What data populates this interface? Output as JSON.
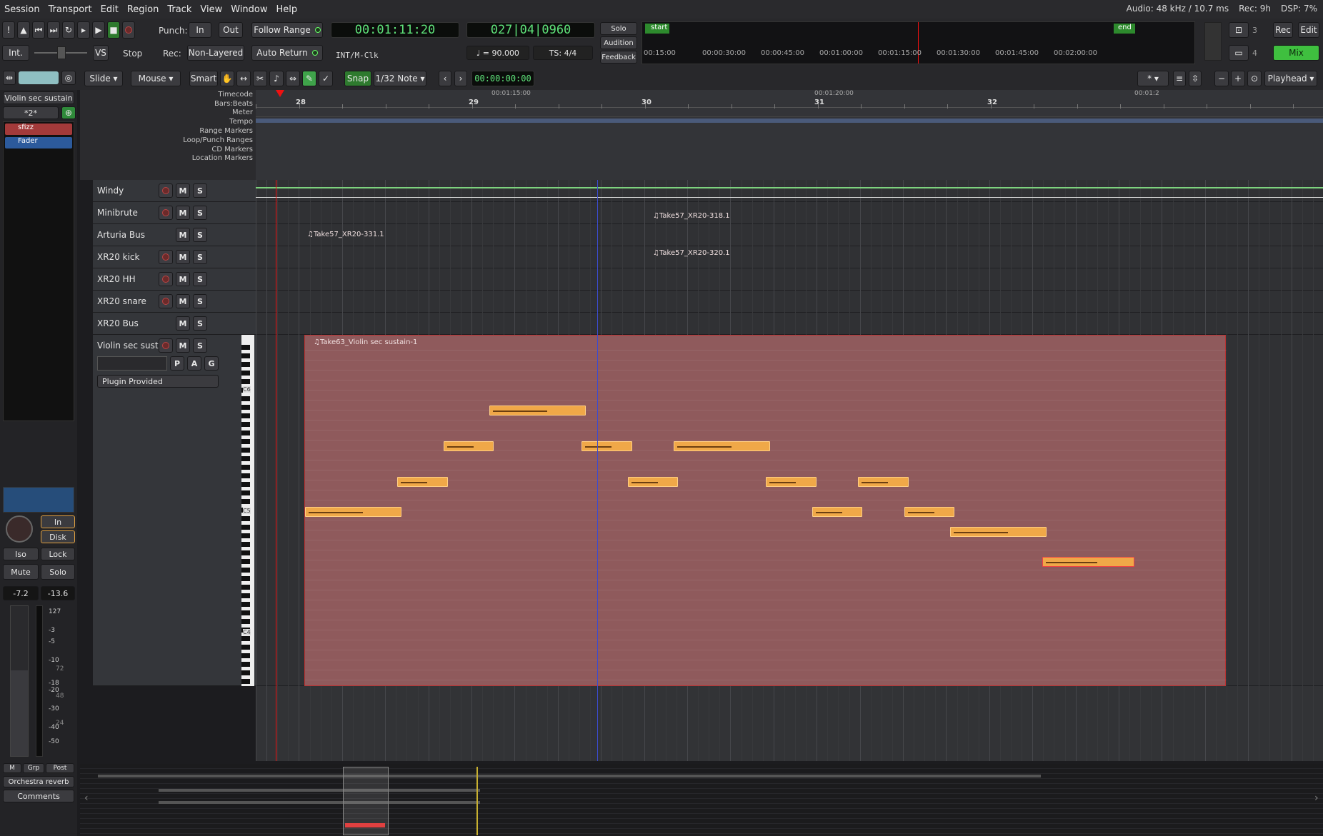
{
  "menu": [
    "Session",
    "Transport",
    "Edit",
    "Region",
    "Track",
    "View",
    "Window",
    "Help"
  ],
  "status": {
    "audio": "Audio: 48 kHz / 10.7 ms",
    "rec": "Rec: 9h",
    "dsp": "DSP:",
    "dsp_val": "7%"
  },
  "transport": {
    "punch_label": "Punch:",
    "punch_in": "In",
    "punch_out": "Out",
    "follow_range": "Follow Range",
    "auto_return": "Auto Return",
    "int": "Int.",
    "vs": "VS",
    "stop": "Stop",
    "rec_label": "Rec:",
    "non_layered": "Non-Layered",
    "timecode": "00:01:11:20",
    "bbt": "027|04|0960",
    "clock_src": "INT/M-Clk",
    "tempo": "♩ = 90.000",
    "ts": "TS: 4/4",
    "solo": "Solo",
    "audition": "Audition",
    "feedback": "Feedback",
    "mini_start": "start",
    "mini_end": "end",
    "mini_ticks": [
      "00:15:00",
      "00:00:30:00",
      "00:00:45:00",
      "00:01:00:00",
      "00:01:15:00",
      "00:01:30:00",
      "00:01:45:00",
      "00:02:00:00"
    ],
    "n3": "3",
    "n4": "4",
    "rec_btn": "Rec",
    "edit_btn": "Edit",
    "mix_btn": "Mix"
  },
  "edit_toolbar": {
    "slide": "Slide",
    "mouse": "Mouse",
    "smart": "Smart",
    "snap": "Snap",
    "grid": "1/32 Note",
    "nudge_clock": "00:00:00:00",
    "playhead": "Playhead",
    "zoom_focus": "*"
  },
  "rulers": {
    "labels": [
      "Timecode",
      "Bars:Beats",
      "Meter",
      "Tempo",
      "Range Markers",
      "Loop/Punch Ranges",
      "CD Markers",
      "Location Markers"
    ],
    "timecode_ticks": [
      "00:01:15:00",
      "00:01:20:00",
      "00:01:2"
    ],
    "bars": [
      "28",
      "29",
      "30",
      "31",
      "32"
    ]
  },
  "tracks": [
    {
      "name": "Windy",
      "rec": true,
      "solo_btn": "S",
      "mute_btn": "M"
    },
    {
      "name": "Minibrute",
      "rec": true,
      "solo_btn": "S",
      "mute_btn": "M"
    },
    {
      "name": "Arturia Bus",
      "rec": false,
      "solo_btn": "S",
      "mute_btn": "M"
    },
    {
      "name": "XR20 kick",
      "rec": true,
      "solo_btn": "S",
      "mute_btn": "M"
    },
    {
      "name": "XR20 HH",
      "rec": true,
      "solo_btn": "S",
      "mute_btn": "M"
    },
    {
      "name": "XR20 snare",
      "rec": true,
      "solo_btn": "S",
      "mute_btn": "M"
    },
    {
      "name": "XR20 Bus",
      "rec": false,
      "solo_btn": "S",
      "mute_btn": "M"
    },
    {
      "name": "Violin sec sustain",
      "rec": true,
      "solo_btn": "S",
      "mute_btn": "M"
    }
  ],
  "violin": {
    "p": "P",
    "a": "A",
    "g": "G",
    "plugin": "Plugin Provided",
    "region": "♫Take63_Violin sec sustain-1",
    "key_c6": "C6",
    "key_c5": "C5",
    "key_c4": "C4"
  },
  "regions": {
    "kick": "♫Take57_XR20-318.1",
    "hh": "♫Take57_XR20-331.1",
    "snare": "♫Take57_XR20-320.1"
  },
  "mixer": {
    "strip_name": "Violin sec sustain",
    "comp": "*2*",
    "plugin1": "sfizz",
    "plugin2": "Fader",
    "in": "In",
    "disk": "Disk",
    "iso": "Iso",
    "lock": "Lock",
    "mute": "Mute",
    "solo": "Solo",
    "gain": "-7.2",
    "peak": "-13.6",
    "m": "M",
    "grp": "Grp",
    "post": "Post",
    "bus": "Orchestra reverb",
    "comments": "Comments",
    "meter_ticks": [
      "127",
      "-3",
      "-5",
      "-10",
      "-18",
      "-20",
      "-30",
      "-40",
      "-50",
      "72",
      "48",
      "24"
    ]
  },
  "notes": [
    {
      "start": 0.0,
      "len": 0.105,
      "pitch": 17
    },
    {
      "start": 0.1,
      "len": 0.055,
      "pitch": 14
    },
    {
      "start": 0.15,
      "len": 0.055,
      "pitch": 11
    },
    {
      "start": 0.2,
      "len": 0.105,
      "pitch": 8
    },
    {
      "start": 0.3,
      "len": 0.055,
      "pitch": 11
    },
    {
      "start": 0.35,
      "len": 0.055,
      "pitch": 14
    },
    {
      "start": 0.4,
      "len": 0.105,
      "pitch": 11
    },
    {
      "start": 0.5,
      "len": 0.055,
      "pitch": 14
    },
    {
      "start": 0.55,
      "len": 0.055,
      "pitch": 17
    },
    {
      "start": 0.6,
      "len": 0.055,
      "pitch": 14
    },
    {
      "start": 0.65,
      "len": 0.055,
      "pitch": 17
    },
    {
      "start": 0.7,
      "len": 0.105,
      "pitch": 19
    },
    {
      "start": 0.8,
      "len": 0.1,
      "pitch": 22
    }
  ],
  "colors": {
    "accent": "#5fe37a",
    "region": "#8f5a5c",
    "note": "#f0a848",
    "playhead": "#e11"
  }
}
